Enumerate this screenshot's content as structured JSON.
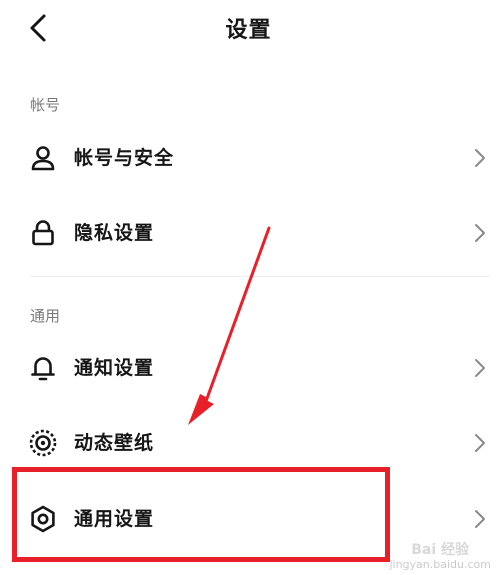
{
  "header": {
    "title": "设置",
    "back_icon": "chevron-left-icon"
  },
  "sections": [
    {
      "label": "帐号",
      "items": [
        {
          "label": "帐号与安全",
          "icon": "person-icon"
        },
        {
          "label": "隐私设置",
          "icon": "lock-icon"
        }
      ]
    },
    {
      "label": "通用",
      "items": [
        {
          "label": "通知设置",
          "icon": "bell-icon"
        },
        {
          "label": "动态壁纸",
          "icon": "dynamic-wallpaper-icon"
        },
        {
          "label": "通用设置",
          "icon": "gear-icon"
        }
      ]
    }
  ],
  "annotation": {
    "highlight_color": "#e8202a",
    "target": "通用设置"
  },
  "watermark": {
    "brand": "Bai 经验",
    "url": "jingyan.baidu.com"
  }
}
